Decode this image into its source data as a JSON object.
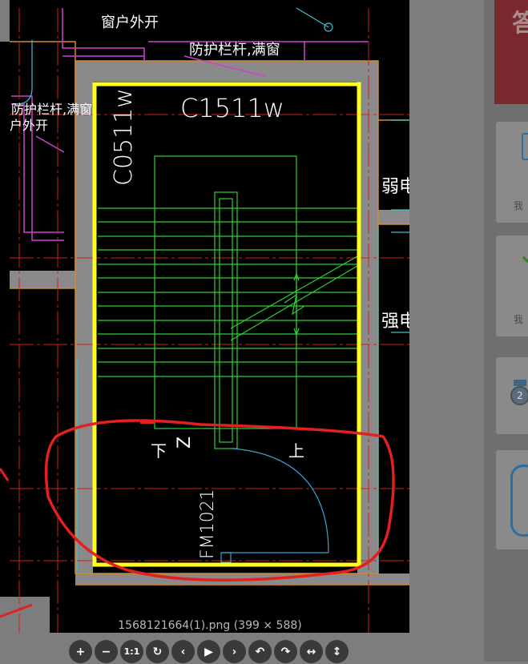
{
  "side_panel": {
    "banner_char": "答",
    "card_texts": [
      "我",
      "我"
    ],
    "medal_label": "2"
  },
  "drawing": {
    "labels": {
      "window_outward": "窗户外开",
      "guard_rail_top": "防护栏杆,满窗",
      "guard_rail_left": "防护栏杆,满窗",
      "window_outward_left": "户外开",
      "window_top": "C1511w",
      "window_left": "C0511w",
      "door": "FM1021",
      "weak_current": "弱电",
      "strong_current": "强电",
      "down": "下",
      "up": "上",
      "z_mark": "Z"
    }
  },
  "viewer": {
    "caption": "1568121664(1).png (399 × 588)",
    "toolbar": [
      {
        "icon": "zoom-in-icon",
        "glyph": "+"
      },
      {
        "icon": "zoom-out-icon",
        "glyph": "−"
      },
      {
        "icon": "actual-size-icon",
        "glyph": "1:1"
      },
      {
        "icon": "reset-icon",
        "glyph": "↻"
      },
      {
        "icon": "prev-icon",
        "glyph": "‹"
      },
      {
        "icon": "play-icon",
        "glyph": "▶"
      },
      {
        "icon": "next-icon",
        "glyph": "›"
      },
      {
        "icon": "rotate-left-icon",
        "glyph": "↶"
      },
      {
        "icon": "rotate-right-icon",
        "glyph": "↷"
      },
      {
        "icon": "flip-horizontal-icon",
        "glyph": "↔"
      },
      {
        "icon": "flip-vertical-icon",
        "glyph": "↕"
      }
    ]
  }
}
